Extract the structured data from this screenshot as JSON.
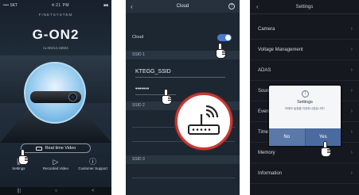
{
  "phone1": {
    "status_left": "•••• SKT",
    "status_mid": "4:21 PM",
    "status_right": "■■",
    "system_title": "FINETSYSTEM",
    "logo": "G-ON2",
    "serial": "ru.00214.16824",
    "realtime_button": "Real time Video",
    "nav": [
      {
        "icon": "settings-sliders-icon",
        "label": "Settings"
      },
      {
        "icon": "play-icon",
        "label": "Recorded Video"
      },
      {
        "icon": "help-circle-icon",
        "label": "Customer Support"
      }
    ],
    "system_buttons": [
      "|||",
      "○",
      "<"
    ]
  },
  "phone2": {
    "title": "Cloud",
    "cloud_label": "Cloud",
    "cloud_enabled": true,
    "ssid1_section": "SSID 1",
    "ssid1_value": "KTEGG_SSID",
    "password_value": "•••••••",
    "ssid2_section": "SSID 2",
    "ssid3_section": "SSID 3"
  },
  "phone3": {
    "title": "Settings",
    "menu": [
      "Camera",
      "Voltage Management",
      "ADAS",
      "Sound",
      "Event",
      "Time",
      "Memory",
      "Information"
    ],
    "dialog": {
      "title": "Settings",
      "message": "카메라 설정을 저장하시겠습니까?",
      "no_label": "No",
      "yes_label": "Yes"
    }
  },
  "colors": {
    "accent": "#4a7bd1",
    "highlight_ring": "#c93a36",
    "dialog_button": "#5a78a8"
  }
}
